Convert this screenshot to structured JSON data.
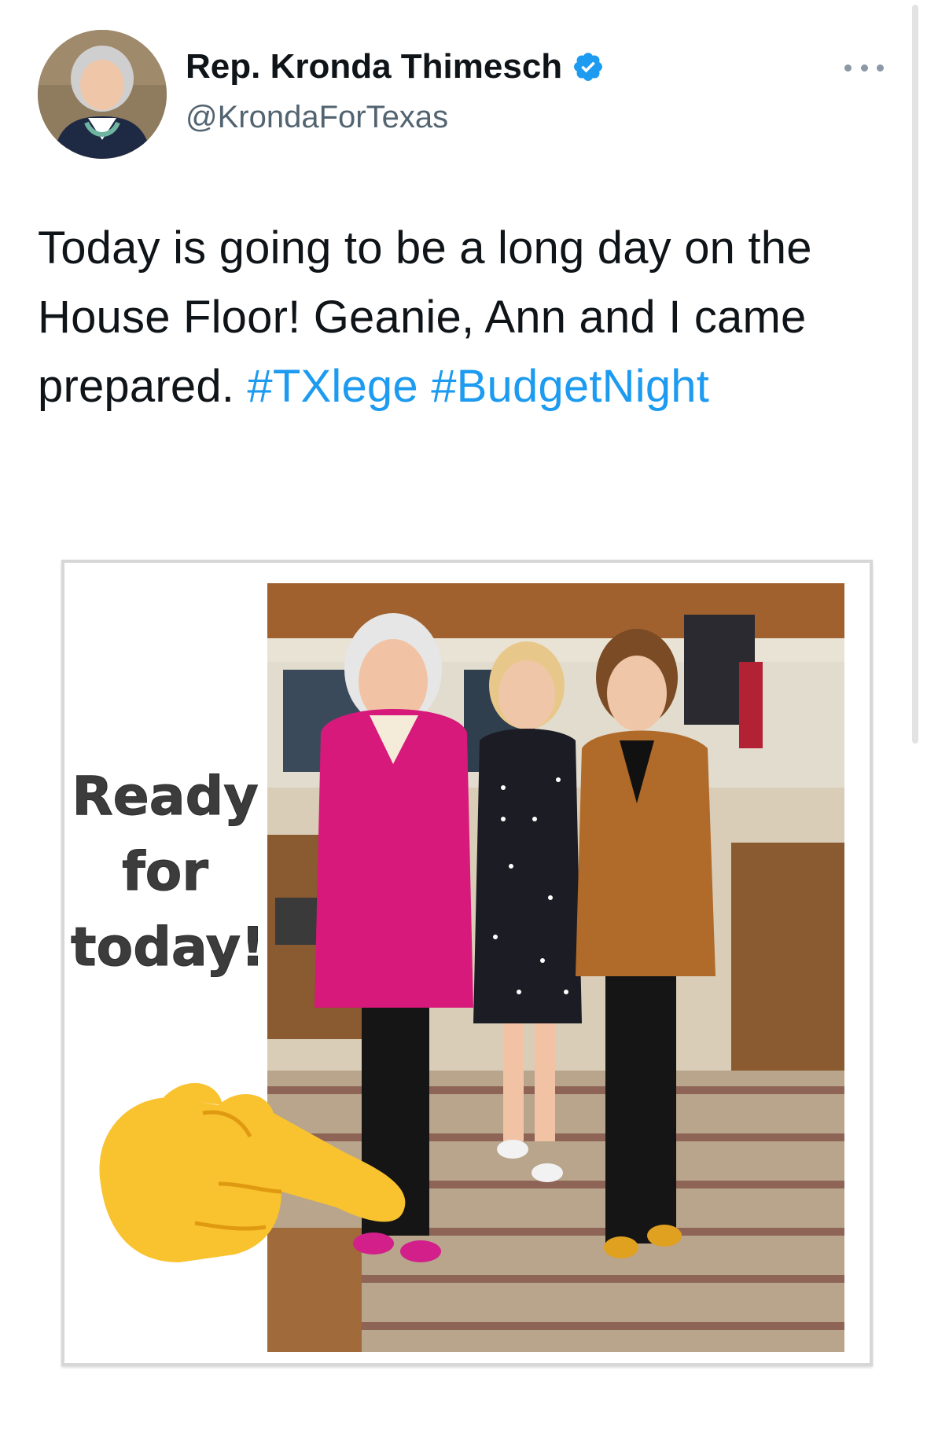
{
  "tweet": {
    "author": {
      "display_name": "Rep. Kronda Thimesch",
      "handle": "@KrondaForTexas",
      "verified": true,
      "avatar_icon": "profile-photo"
    },
    "text_before_hashtags": "Today is going to be a long day on the House Floor! Geanie, Ann and I came prepared.",
    "hashtags": [
      "#TXlege",
      "#BudgetNight"
    ],
    "more_icon": "ellipsis-icon"
  },
  "media": {
    "caption_lines": [
      "Ready",
      "for",
      "today!"
    ],
    "emoji": "backhand-index-pointing-right",
    "photo_subject": "three-women-on-house-floor"
  },
  "colors": {
    "hashtag": "#1d9bf0",
    "verified": "#1d9bf0",
    "handle": "#536471",
    "text": "#0f1419"
  }
}
